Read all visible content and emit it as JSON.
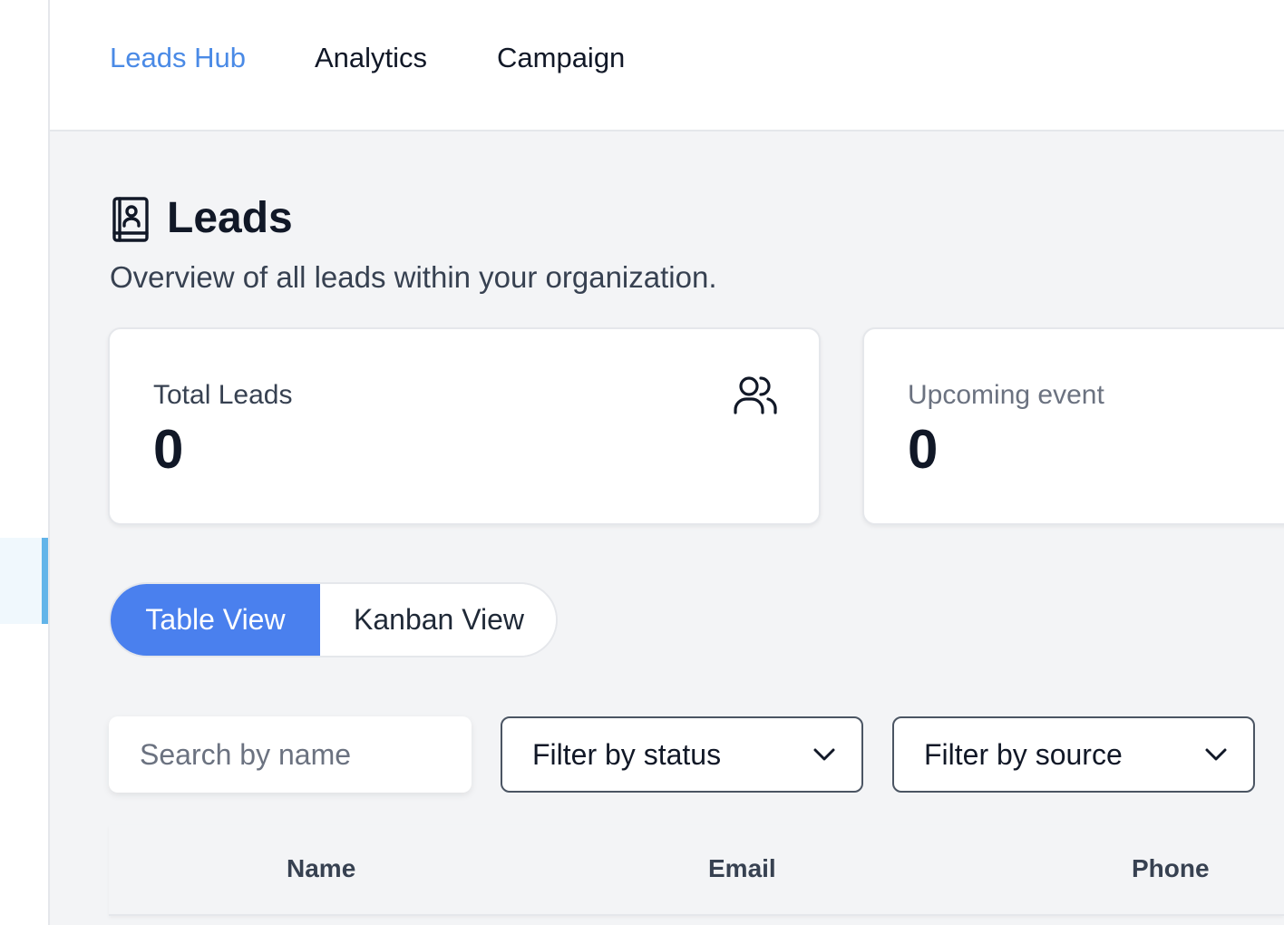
{
  "nav": {
    "tabs": [
      {
        "label": "Leads Hub",
        "active": true
      },
      {
        "label": "Analytics",
        "active": false
      },
      {
        "label": "Campaign",
        "active": false
      }
    ]
  },
  "page": {
    "icon": "contact-book-icon",
    "title": "Leads",
    "subtitle": "Overview of all leads within your organization."
  },
  "stats": {
    "total_leads": {
      "label": "Total Leads",
      "value": "0",
      "icon": "users-icon"
    },
    "upcoming_event": {
      "label": "Upcoming event",
      "value": "0"
    }
  },
  "view_toggle": {
    "table_label": "Table View",
    "kanban_label": "Kanban View",
    "selected": "Table View"
  },
  "filters": {
    "search_placeholder": "Search by name",
    "status_label": "Filter by status",
    "source_label": "Filter by source"
  },
  "table": {
    "columns": [
      "Name",
      "Email",
      "Phone"
    ]
  },
  "colors": {
    "accent": "#4a80ee",
    "nav_active": "#4a8ae6",
    "sidebar_indicator": "#62b4e9",
    "background": "#f3f4f6"
  }
}
